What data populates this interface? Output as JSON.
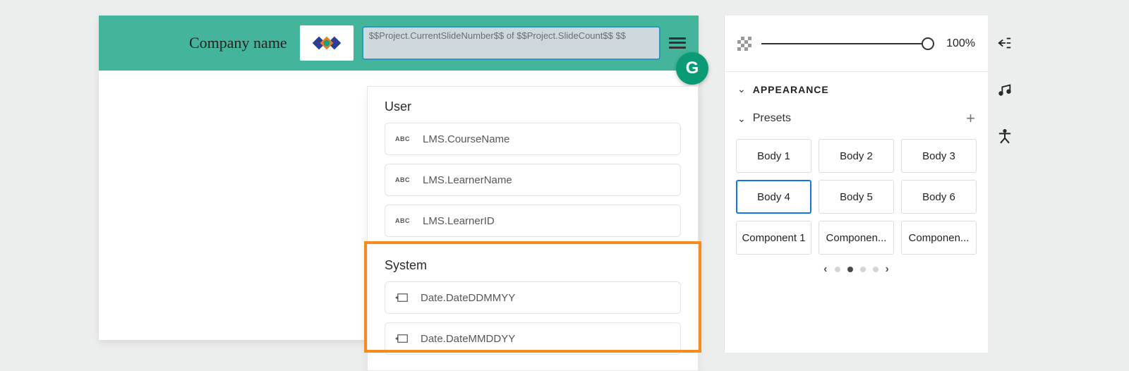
{
  "header": {
    "company_label": "Company name",
    "variable_text": "$$Project.CurrentSlideNumber$$ of $$Project.SlideCount$$ $$"
  },
  "dropdown": {
    "sections": [
      {
        "title": "User",
        "items": [
          {
            "icon": "abc",
            "label": "LMS.CourseName"
          },
          {
            "icon": "abc",
            "label": "LMS.LearnerName"
          },
          {
            "icon": "abc",
            "label": "LMS.LearnerID"
          }
        ]
      },
      {
        "title": "System",
        "items": [
          {
            "icon": "sys",
            "label": "Date.DateDDMMYY"
          },
          {
            "icon": "sys",
            "label": "Date.DateMMDDYY"
          }
        ]
      }
    ]
  },
  "right_panel": {
    "opacity": {
      "value_label": "100%"
    },
    "appearance_title": "APPEARANCE",
    "presets_title": "Presets",
    "presets": [
      {
        "label": "Body 1",
        "selected": false
      },
      {
        "label": "Body 2",
        "selected": false
      },
      {
        "label": "Body 3",
        "selected": false
      },
      {
        "label": "Body 4",
        "selected": true
      },
      {
        "label": "Body 5",
        "selected": false
      },
      {
        "label": "Body 6",
        "selected": false
      },
      {
        "label": "Component 1",
        "selected": false
      },
      {
        "label": "Componen...",
        "selected": false
      },
      {
        "label": "Componen...",
        "selected": false
      }
    ],
    "pager": {
      "total": 4,
      "active": 1
    }
  }
}
